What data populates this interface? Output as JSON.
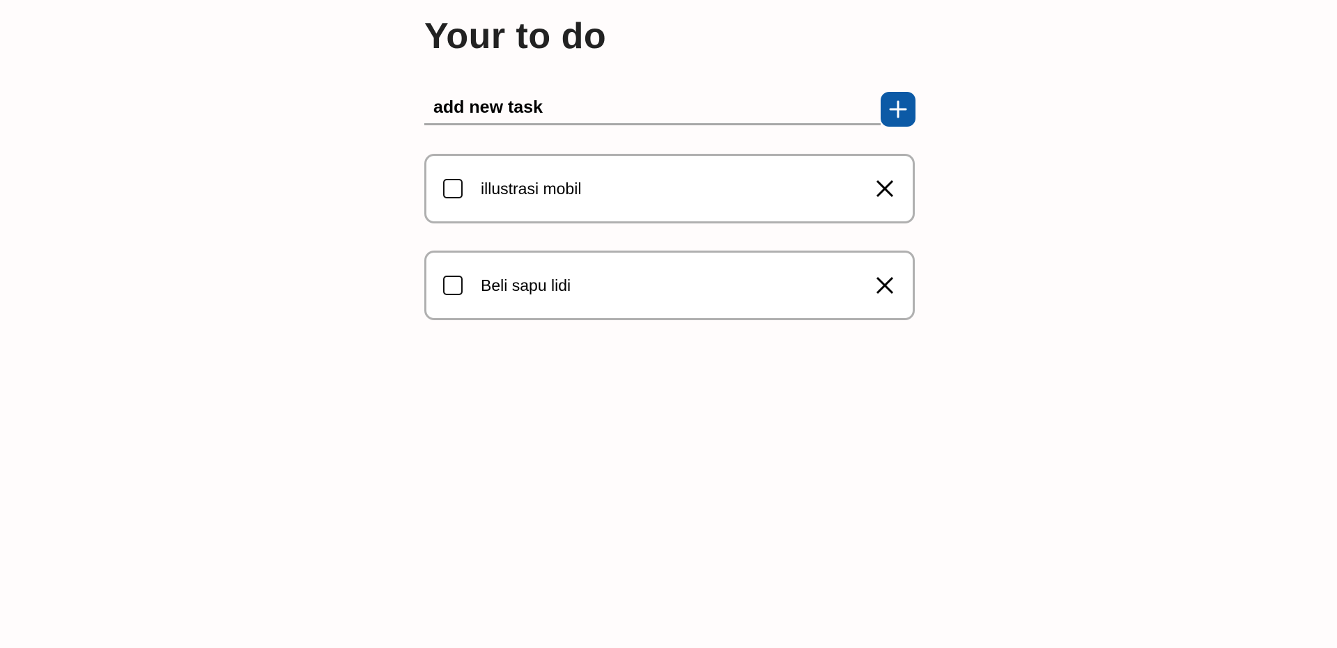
{
  "page": {
    "title": "Your to do"
  },
  "new_task": {
    "value": "add new task",
    "placeholder": "add new task"
  },
  "icons": {
    "add": "plus-icon",
    "delete": "close-icon"
  },
  "colors": {
    "accent": "#0c5aa6",
    "background": "#fffcfc",
    "border": "#b0b0b0"
  },
  "tasks": [
    {
      "label": "illustrasi mobil",
      "done": false
    },
    {
      "label": "Beli sapu lidi",
      "done": false
    }
  ]
}
